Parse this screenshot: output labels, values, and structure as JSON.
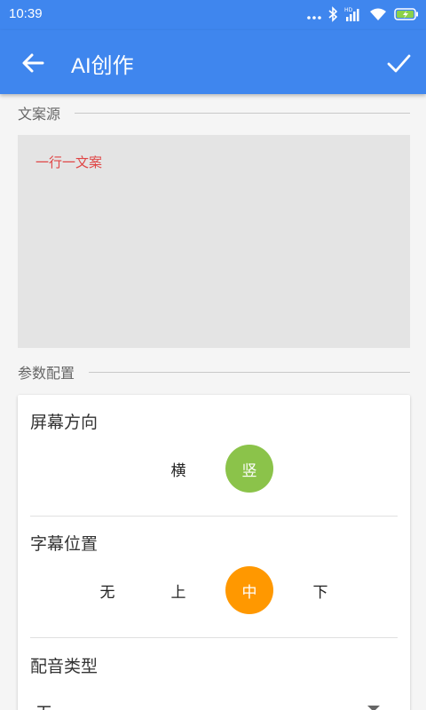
{
  "status_bar": {
    "time": "10:39",
    "icons": [
      "more-dots-icon",
      "bluetooth-icon",
      "hd-signal-icon",
      "wifi-icon",
      "battery-charging-icon"
    ],
    "signal_label": "HD"
  },
  "app_bar": {
    "title": "AI创作",
    "back_icon": "arrow-back-icon",
    "confirm_icon": "check-icon",
    "color": "#3f86ee"
  },
  "source_section": {
    "label": "文案源",
    "placeholder": "一行一文案"
  },
  "params_section": {
    "label": "参数配置",
    "screen_orientation": {
      "title": "屏幕方向",
      "options": [
        "横",
        "竖"
      ],
      "selected": "竖",
      "selected_color": "#8bc34a"
    },
    "subtitle_position": {
      "title": "字幕位置",
      "options": [
        "无",
        "上",
        "中",
        "下"
      ],
      "selected": "中",
      "selected_color": "#ff9800"
    },
    "voice_type": {
      "title": "配音类型",
      "value": "无"
    }
  }
}
